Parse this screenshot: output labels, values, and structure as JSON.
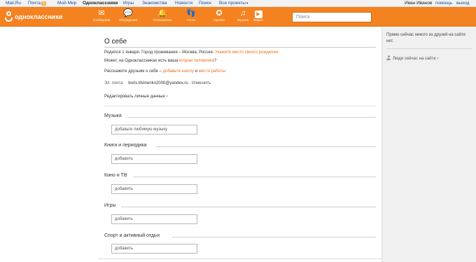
{
  "topbar": {
    "mailru": "Mail.Ru",
    "mail": "Почта",
    "mail_badge": "1",
    "myworld": "Мой Мир",
    "ok": "Одноклассники",
    "games": "Игры",
    "dating": "Знакомства",
    "news": "Новости",
    "search": "Поиск",
    "all_projects": "Все проекты",
    "user_name": "Иван Иванов",
    "help": "помощь",
    "exit": "выход"
  },
  "header": {
    "logo_text": "одноклассники",
    "nav": [
      {
        "label": "Сообщения",
        "icon": "envelope-icon"
      },
      {
        "label": "Обсуждения",
        "icon": "chat-icon"
      },
      {
        "label": "Оповещения",
        "icon": "bell-icon"
      },
      {
        "label": "Гости",
        "icon": "footprints-icon"
      },
      {
        "label": "Оценки",
        "icon": "rating-icon"
      },
      {
        "label": "Музыка",
        "icon": "music-note-icon"
      },
      {
        "label": "Видео",
        "icon": "video-play-icon"
      }
    ],
    "search_placeholder": "Поиск",
    "accent_color": "#f58220"
  },
  "main": {
    "title": "О себе",
    "line1_text": "Родился 1 января. Город проживания – Москва, Россия.",
    "line1_link": "Укажите место своего рождения.",
    "line2_text": "Может, на Одноклассниках есть ваша",
    "line2_link": "вторая половинка",
    "line2_end": "?",
    "line3_text": "Расскажите друзьям о себе –",
    "line3_link1": "добавьте школу",
    "line3_and": "и",
    "line3_link2": "место работы",
    "email_label": "Эл. почта",
    "email_value": "boris.litvinenko2000@yandex.ru",
    "email_change": "· Изменить",
    "edit_link": "Редактировать личные данные ›",
    "sections": [
      {
        "title": "Музыка",
        "placeholder": "добавьте любимую музыку"
      },
      {
        "title": "Книги и периодика",
        "placeholder": "добавить"
      },
      {
        "title": "Кино и ТВ",
        "placeholder": "добавить"
      },
      {
        "title": "Игры",
        "placeholder": "добавить"
      },
      {
        "title": "Спорт и активный отдых",
        "placeholder": "добавить"
      }
    ]
  },
  "right": {
    "note": "Прямо сейчас никого из друзей на сайте нет.",
    "online_link": "Люди сейчас на сайте ›"
  }
}
